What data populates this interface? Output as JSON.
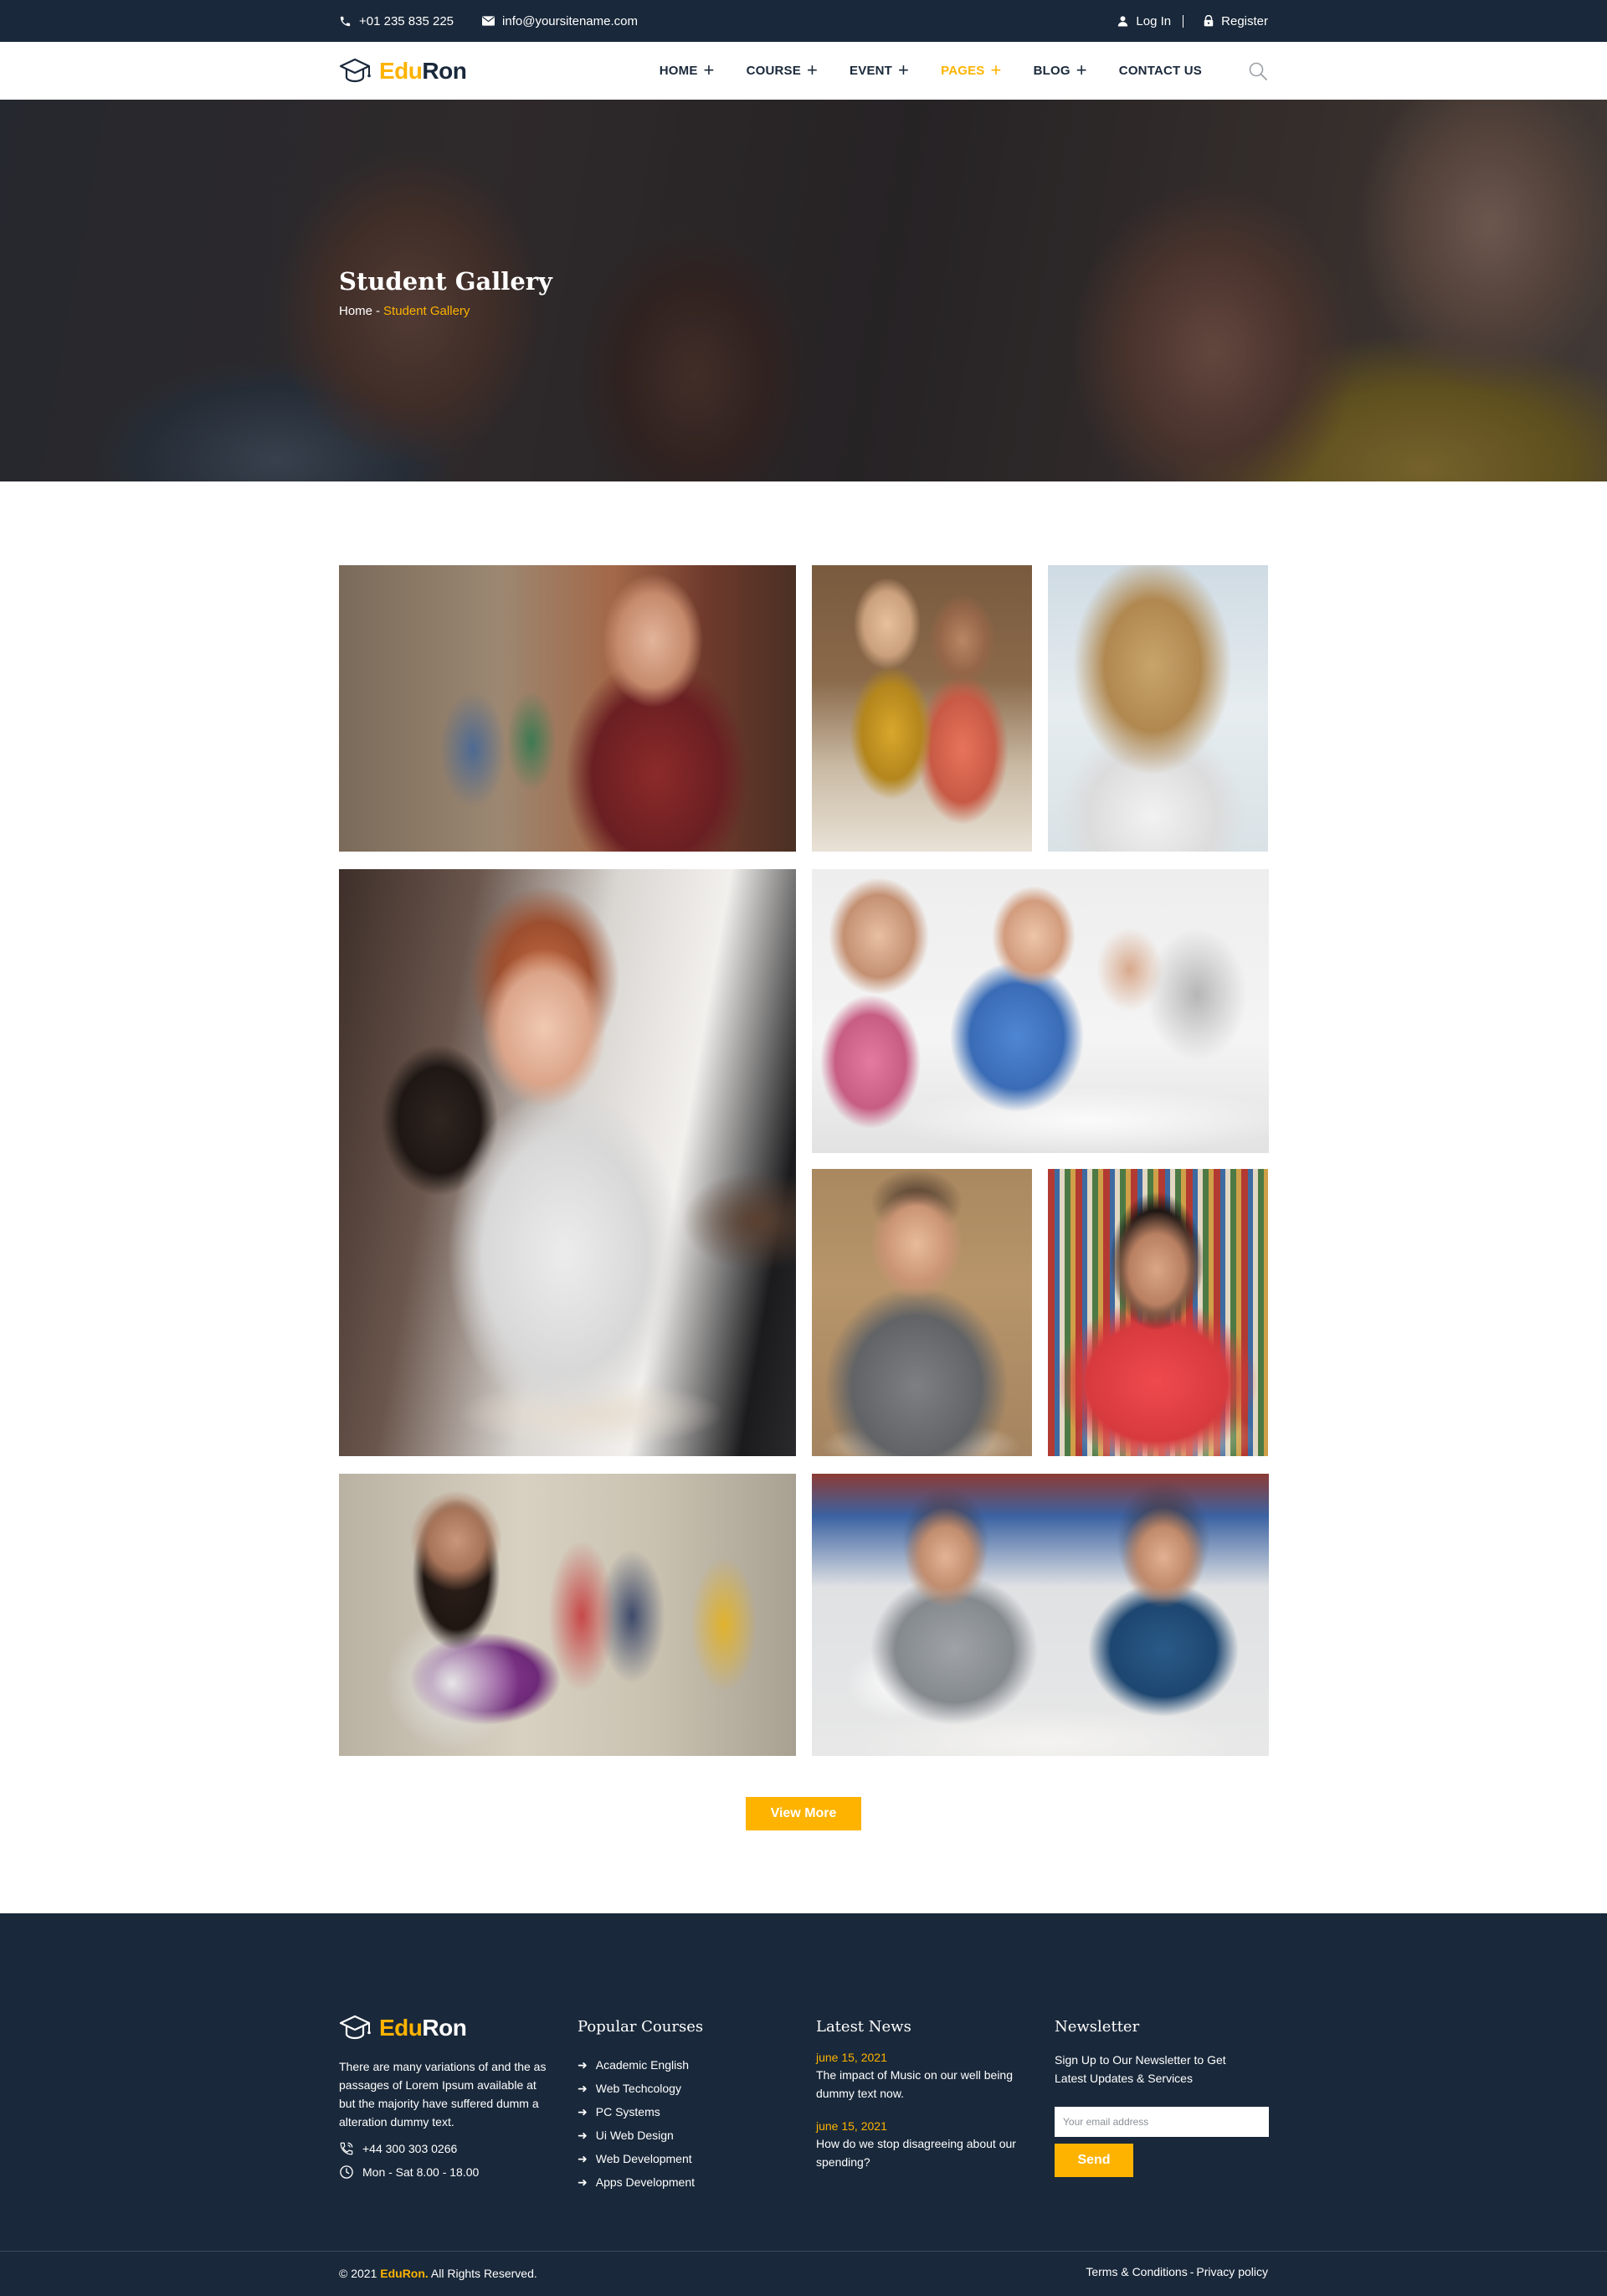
{
  "topbar": {
    "phone": "+01 235 835 225",
    "email": "info@yoursitename.com",
    "login_label": "Log In",
    "register_label": "Register"
  },
  "brand": {
    "part1": "Edu",
    "part2": "Ron"
  },
  "nav": {
    "items": [
      {
        "label": "HOME",
        "plus": "+"
      },
      {
        "label": "COURSE",
        "plus": "+"
      },
      {
        "label": "EVENT",
        "plus": "+"
      },
      {
        "label": "PAGES",
        "plus": "+"
      },
      {
        "label": "BLOG",
        "plus": "+"
      },
      {
        "label": "CONTACT US"
      }
    ],
    "active": "PAGES"
  },
  "hero": {
    "title": "Student Gallery",
    "crumb_home": "Home",
    "crumb_sep": "-",
    "crumb_current": "Student Gallery"
  },
  "gallery": {
    "view_more_label": "View More"
  },
  "footer": {
    "about": {
      "text": "There are many variations of and the as passages of Lorem Ipsum available at but the majority have suffered dumm a alteration dummy text.",
      "phone": "+44 300 303 0266",
      "hours": "Mon - Sat 8.00 - 18.00"
    },
    "courses": {
      "heading": "Popular Courses",
      "items": [
        "Academic English",
        "Web Techcology",
        "PC Systems",
        "Ui Web Design",
        "Web Development",
        "Apps Development"
      ]
    },
    "news": {
      "heading": "Latest News",
      "items": [
        {
          "date": "june 15, 2021",
          "title": "The impact of Music on our well being dummy text now."
        },
        {
          "date": "june 15, 2021",
          "title": "How do we stop disagreeing about our spending?"
        }
      ]
    },
    "newsletter": {
      "heading": "Newsletter",
      "text": "Sign Up to Our Newsletter to Get Latest Updates & Services",
      "placeholder": "Your email address",
      "send_label": "Send"
    },
    "copyright_prefix": "© 2021",
    "copyright_brand": "EduRon.",
    "copyright_suffix": "All Rights Reserved.",
    "terms_label": "Terms & Conditions",
    "legal_sep": "-",
    "privacy_label": "Privacy policy"
  },
  "colors": {
    "navy": "#19283a",
    "accent": "#fdb300"
  }
}
